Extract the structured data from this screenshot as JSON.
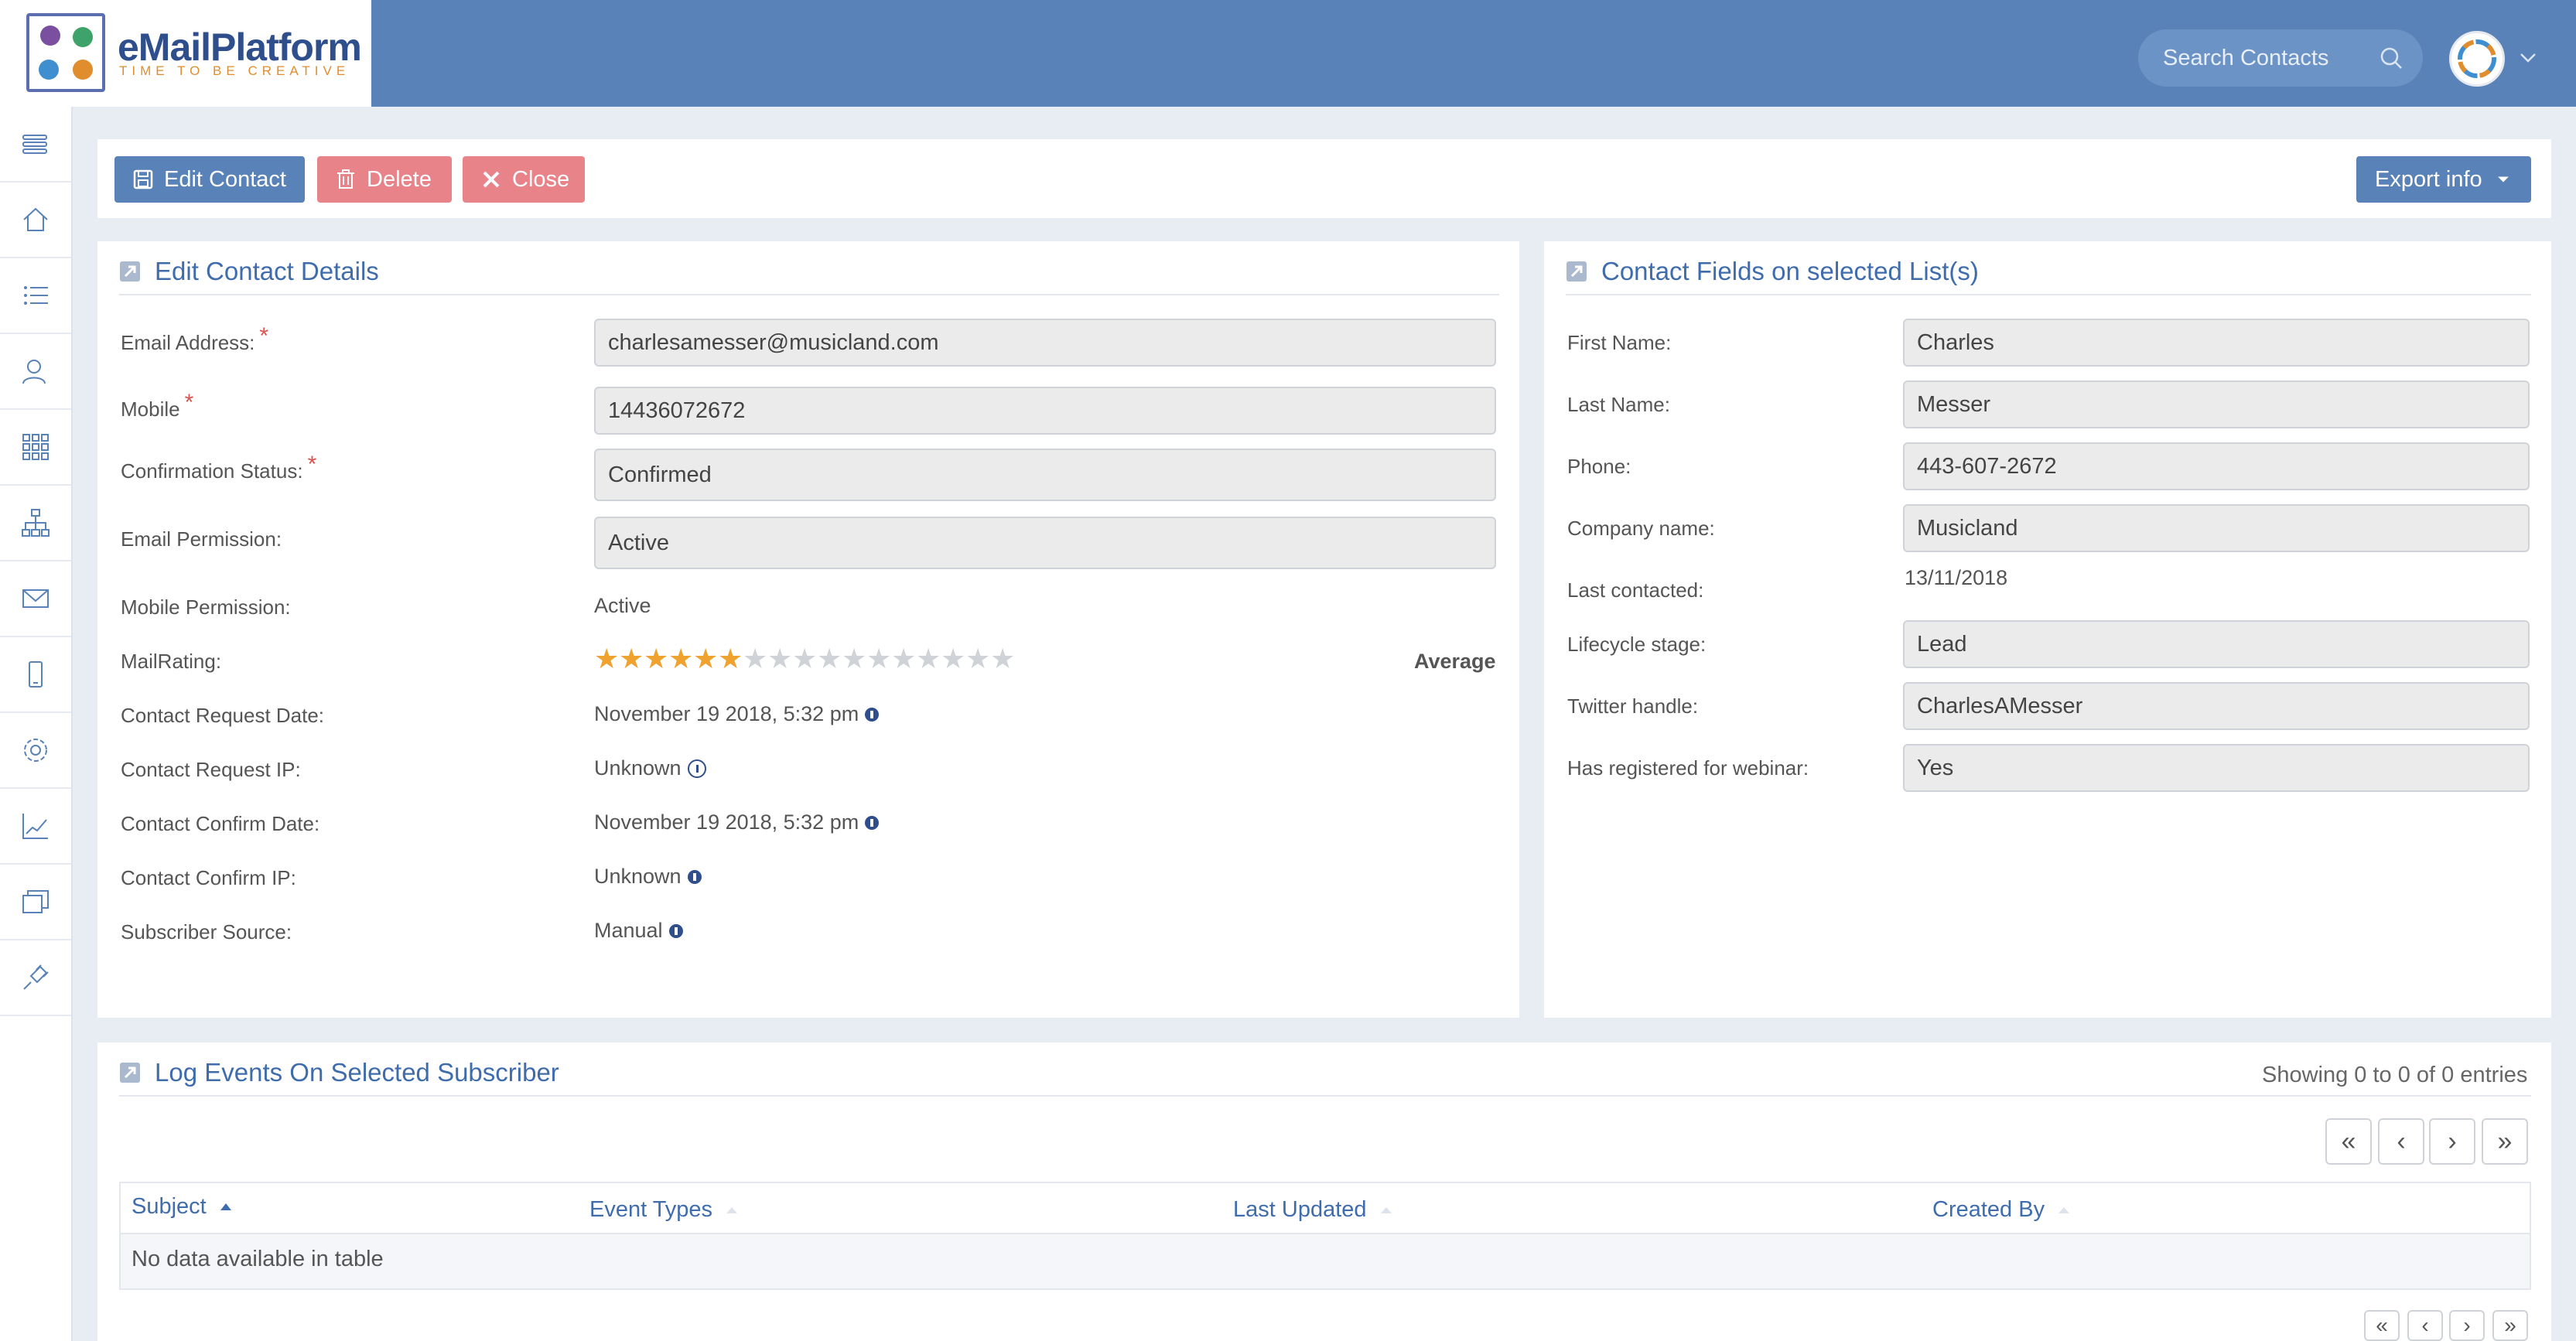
{
  "app": {
    "logo_name": "eMailPlatform",
    "logo_tagline": "TIME TO BE CREATIVE"
  },
  "header": {
    "search_placeholder": "Search Contacts"
  },
  "sidebar": {
    "items": [
      "menu-icon",
      "home-icon",
      "list-icon",
      "contacts-icon",
      "grid-icon",
      "sitemap-icon",
      "mail-icon",
      "mobile-icon",
      "settings-icon",
      "chart-icon",
      "layers-icon",
      "plug-icon"
    ]
  },
  "toolbar": {
    "edit_label": "Edit Contact",
    "delete_label": "Delete",
    "close_label": "Close",
    "export_label": "Export info"
  },
  "contact_details": {
    "title": "Edit Contact Details",
    "email_label": "Email Address:",
    "email_value": "charlesamesser@musicland.com",
    "mobile_label": "Mobile",
    "mobile_value": "14436072672",
    "confirmation_label": "Confirmation Status:",
    "confirmation_value": "Confirmed",
    "email_permission_label": "Email Permission:",
    "email_permission_value": "Active",
    "mobile_permission_label": "Mobile Permission:",
    "mobile_permission_value": "Active",
    "mailrating_label": "MailRating:",
    "mailrating_text": "Average",
    "mailrating_stars": 6,
    "mailrating_max": 17,
    "request_date_label": "Contact Request Date:",
    "request_date_value": "November 19 2018, 5:32 pm",
    "request_ip_label": "Contact Request IP:",
    "request_ip_value": "Unknown",
    "confirm_date_label": "Contact Confirm Date:",
    "confirm_date_value": "November 19 2018, 5:32 pm",
    "confirm_ip_label": "Contact Confirm IP:",
    "confirm_ip_value": "Unknown",
    "source_label": "Subscriber Source:",
    "source_value": "Manual"
  },
  "contact_fields": {
    "title": "Contact Fields on selected List(s)",
    "first_name_label": "First Name:",
    "first_name_value": "Charles",
    "last_name_label": "Last Name:",
    "last_name_value": "Messer",
    "phone_label": "Phone:",
    "phone_value": "443-607-2672",
    "company_label": "Company name:",
    "company_value": "Musicland",
    "last_contacted_label": "Last contacted:",
    "last_contacted_value": "13/11/2018",
    "lifecycle_label": "Lifecycle stage:",
    "lifecycle_value": "Lead",
    "twitter_label": "Twitter handle:",
    "twitter_value": "CharlesAMesser",
    "webinar_label": "Has registered for webinar:",
    "webinar_value": "Yes"
  },
  "log_events": {
    "title": "Log Events On Selected Subscriber",
    "showing": "Showing 0 to 0 of 0 entries",
    "columns": [
      "Subject",
      "Event Types",
      "Last Updated",
      "Created By"
    ],
    "empty_message": "No data available in table",
    "pager": [
      "«",
      "‹",
      "›",
      "»"
    ]
  },
  "colors": {
    "brand_blue": "#5882b8",
    "danger_red": "#e8838a",
    "star_on": "#f0a22e"
  }
}
